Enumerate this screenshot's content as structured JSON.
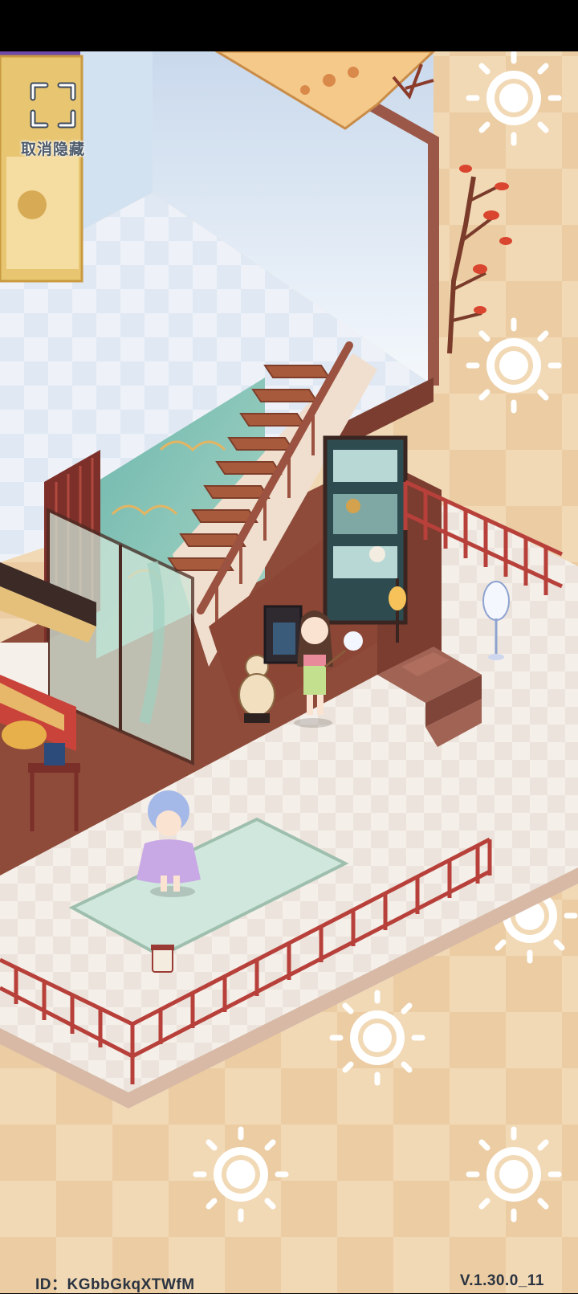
{
  "unhide": {
    "label": "取消隐藏",
    "icon": "expand-corners-icon"
  },
  "footer": {
    "player_id": "ID：KGbbGkqXTWfM",
    "version": "V.1.30.0_11"
  },
  "colors": {
    "background": "#f2d9b6",
    "checker": "#e8c9a0",
    "railing": "#b8403a",
    "floor": "#f4ede6",
    "stairs": "#a85a3c",
    "wall_blue": "#dce9f5"
  }
}
